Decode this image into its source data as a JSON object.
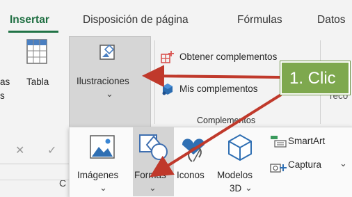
{
  "tabs": [
    {
      "label": "Insertar",
      "active": true
    },
    {
      "label": "Disposición de página"
    },
    {
      "label": "Fórmulas"
    },
    {
      "label": "Datos"
    }
  ],
  "ribbon": {
    "partial_label_line1": "as",
    "partial_label_line2": "s",
    "tabla_label": "Tabla",
    "ilustraciones_label": "Ilustraciones",
    "obtener_label": "Obtener complementos",
    "mis_label": "Mis complementos",
    "complementos_group": "Complementos",
    "reco_label": "reco"
  },
  "callout": {
    "text": "1. Clic",
    "color": "#7ea84e"
  },
  "arrow_color": "#c0392b",
  "formula_bar": {
    "cancel_glyph": "✕",
    "enter_glyph": "✓",
    "column_letter": "C"
  },
  "dropdown": {
    "imagenes_label": "Imágenes",
    "formas_label": "Formas",
    "iconos_label": "Iconos",
    "modelos_label_line1": "Modelos",
    "modelos_label_line2": "3D",
    "smartart_label": "SmartArt",
    "captura_label": "Captura"
  },
  "chevron_glyph": "⌄",
  "accent": "#217346"
}
